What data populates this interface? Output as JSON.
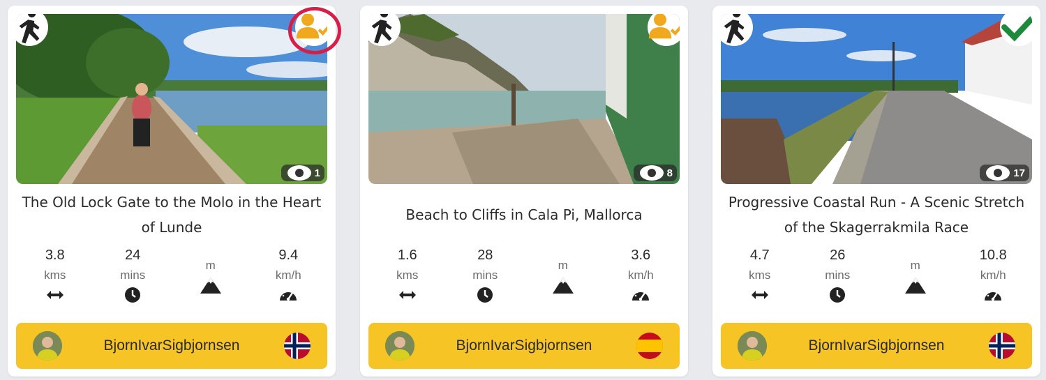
{
  "cards": [
    {
      "activity_icon": "running-person-icon",
      "status_icon": "user-check-icon",
      "views": "1",
      "title": "The Old Lock Gate to the Molo in the Heart of Lunde",
      "distance": {
        "value": "3.8",
        "unit": "kms",
        "icon": "arrows-horizontal-icon"
      },
      "duration": {
        "value": "24",
        "unit": "mins",
        "icon": "clock-icon"
      },
      "elevation": {
        "value": "",
        "unit": "m",
        "icon": "mountain-icon"
      },
      "speed": {
        "value": "9.4",
        "unit": "km/h",
        "icon": "speedometer-icon"
      },
      "user": {
        "name": "BjornIvarSigbjornsen",
        "flag": "norway-flag"
      }
    },
    {
      "activity_icon": "running-person-icon",
      "status_icon": "user-check-icon",
      "views": "8",
      "title": "Beach to Cliffs in Cala Pi, Mallorca",
      "distance": {
        "value": "1.6",
        "unit": "kms",
        "icon": "arrows-horizontal-icon"
      },
      "duration": {
        "value": "28",
        "unit": "mins",
        "icon": "clock-icon"
      },
      "elevation": {
        "value": "",
        "unit": "m",
        "icon": "mountain-icon"
      },
      "speed": {
        "value": "3.6",
        "unit": "km/h",
        "icon": "speedometer-icon"
      },
      "user": {
        "name": "BjornIvarSigbjornsen",
        "flag": "spain-flag"
      }
    },
    {
      "activity_icon": "running-person-icon",
      "status_icon": "checkmark-icon",
      "views": "17",
      "title": "Progressive Coastal Run - A Scenic Stretch of the Skagerrakmila Race",
      "distance": {
        "value": "4.7",
        "unit": "kms",
        "icon": "arrows-horizontal-icon"
      },
      "duration": {
        "value": "26",
        "unit": "mins",
        "icon": "clock-icon"
      },
      "elevation": {
        "value": "",
        "unit": "m",
        "icon": "mountain-icon"
      },
      "speed": {
        "value": "10.8",
        "unit": "km/h",
        "icon": "speedometer-icon"
      },
      "user": {
        "name": "BjornIvarSigbjornsen",
        "flag": "norway-flag"
      }
    }
  ],
  "colors": {
    "accent_yellow": "#f6c424",
    "status_orange": "#f0a81e",
    "check_green": "#1c8a3a",
    "highlight_red": "#d81e48"
  }
}
